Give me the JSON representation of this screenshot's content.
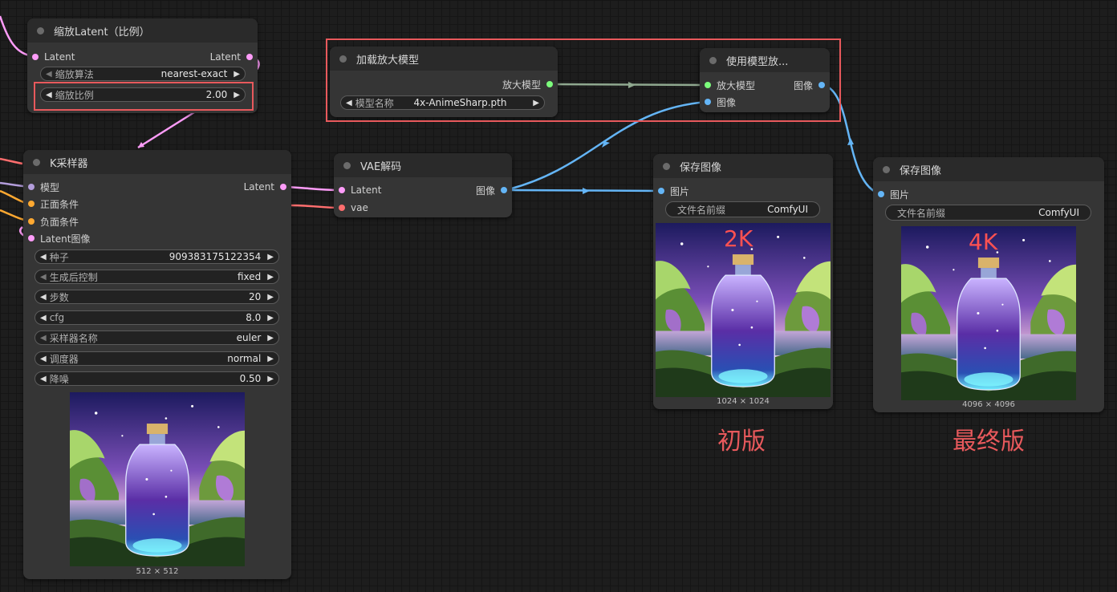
{
  "colors": {
    "latent": "#ff9cf9",
    "model": "#b39ddb",
    "conditioning": "#ffa931",
    "vae": "#ff6e6e",
    "image": "#64b5f6",
    "upscale_model": "#7cfc7c",
    "highlight": "#e8595c"
  },
  "nodes": {
    "latent_upscale": {
      "title": "缩放Latent（比例）",
      "in_latent": "Latent",
      "out_latent": "Latent",
      "method_label": "缩放算法",
      "method_value": "nearest-exact",
      "scale_label": "缩放比例",
      "scale_value": "2.00"
    },
    "ksampler": {
      "title": "K采样器",
      "in_model": "模型",
      "in_positive": "正面条件",
      "in_negative": "负面条件",
      "in_latent": "Latent图像",
      "out_latent": "Latent",
      "seed_label": "种子",
      "seed_value": "909383175122354",
      "control_label": "生成后控制",
      "control_value": "fixed",
      "steps_label": "步数",
      "steps_value": "20",
      "cfg_label": "cfg",
      "cfg_value": "8.0",
      "sampler_label": "采样器名称",
      "sampler_value": "euler",
      "scheduler_label": "调度器",
      "scheduler_value": "normal",
      "denoise_label": "降噪",
      "denoise_value": "0.50",
      "preview_size": "512 × 512"
    },
    "vae_decode": {
      "title": "VAE解码",
      "in_latent": "Latent",
      "in_vae": "vae",
      "out_image": "图像"
    },
    "upscale_loader": {
      "title": "加载放大模型",
      "out_model": "放大模型",
      "model_label": "模型名称",
      "model_value": "4x-AnimeSharp.pth"
    },
    "upscale_with_model": {
      "title": "使用模型放...",
      "in_model": "放大模型",
      "in_image": "图像",
      "out_image": "图像"
    },
    "save_2k": {
      "title": "保存图像",
      "in_image": "图片",
      "prefix_label": "文件名前缀",
      "prefix_value": "ComfyUI",
      "preview_size": "1024 × 1024",
      "overlay": "2K"
    },
    "save_4k": {
      "title": "保存图像",
      "in_image": "图片",
      "prefix_label": "文件名前缀",
      "prefix_value": "ComfyUI",
      "preview_size": "4096 × 4096",
      "overlay": "4K"
    }
  },
  "annotations": {
    "first_version": "初版",
    "final_version": "最终版"
  }
}
